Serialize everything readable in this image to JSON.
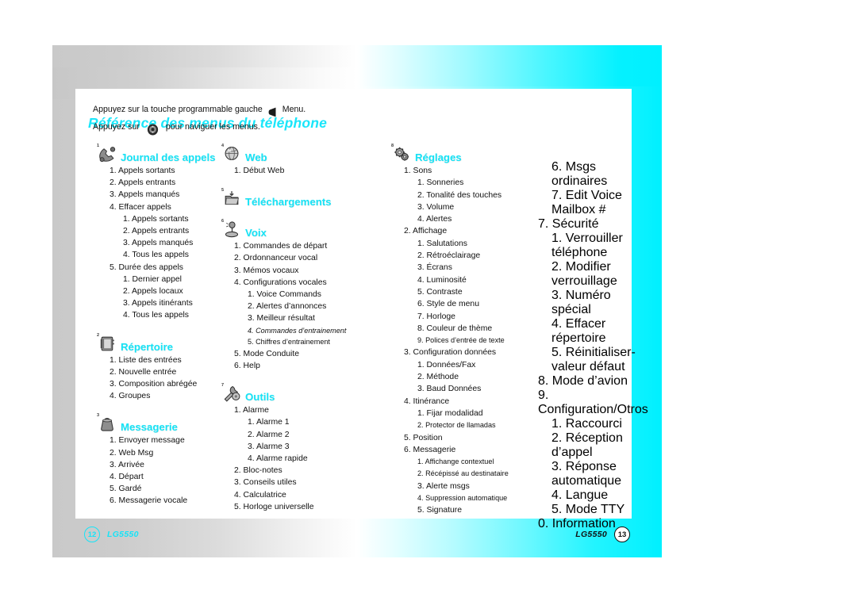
{
  "document": {
    "title": "Référence des menus du téléphone",
    "intro": [
      {
        "before": "Appuyez sur la touche programmable gauche",
        "icon": "softkey-icon",
        "after": "Menu."
      },
      {
        "before": "Appuyez sur",
        "icon": "navigation-key-icon",
        "after": "pour naviguer les menus."
      }
    ]
  },
  "footer": {
    "left": {
      "page": "12",
      "brand": "LG5550"
    },
    "right": {
      "page": "13",
      "brand": "LG5550"
    }
  },
  "colors": {
    "accent_cyan": "#16e4f7",
    "page_right_bg": "#00f0ff",
    "page_left_bg": "#cccccc",
    "text": "#111111"
  },
  "columns": [
    {
      "id": "column-1",
      "sections": [
        {
          "num": "1",
          "title": "Journal des appels",
          "icon": "phone-handset-icon",
          "items": [
            {
              "label": "1. Appels sortants"
            },
            {
              "label": "2. Appels entrants"
            },
            {
              "label": "3. Appels manqués"
            },
            {
              "label": "4. Effacer appels",
              "children": [
                {
                  "label": "1. Appels sortants"
                },
                {
                  "label": "2. Appels entrants"
                },
                {
                  "label": "3. Appels manqués"
                },
                {
                  "label": "4. Tous les appels"
                }
              ]
            },
            {
              "label": "5. Durée des appels",
              "children": [
                {
                  "label": "1. Dernier appel"
                },
                {
                  "label": "2. Appels locaux"
                },
                {
                  "label": "3. Appels itinérants"
                },
                {
                  "label": "4. Tous les appels"
                }
              ]
            }
          ]
        },
        {
          "num": "2",
          "title": "Répertoire",
          "icon": "address-book-icon",
          "items": [
            {
              "label": "1. Liste des entrées"
            },
            {
              "label": "2. Nouvelle entrée"
            },
            {
              "label": "3. Composition abrégée"
            },
            {
              "label": "4. Groupes"
            }
          ]
        },
        {
          "num": "3",
          "title": "Messagerie",
          "icon": "mailbag-icon",
          "items": [
            {
              "label": "1. Envoyer message"
            },
            {
              "label": "2. Web Msg"
            },
            {
              "label": "3. Arrivée"
            },
            {
              "label": "4. Départ"
            },
            {
              "label": "5. Gardé"
            },
            {
              "label": "6. Messagerie vocale"
            }
          ]
        }
      ]
    },
    {
      "id": "column-2",
      "sections": [
        {
          "num": "4",
          "title": "Web",
          "icon": "globe-icon",
          "items": [
            {
              "label": "1. Début Web"
            }
          ]
        },
        {
          "num": "5",
          "title": "Téléchargements",
          "icon": "download-folder-icon",
          "items": []
        },
        {
          "num": "6",
          "title": "Voix",
          "icon": "microphone-icon",
          "items": [
            {
              "label": "1. Commandes de départ"
            },
            {
              "label": "2. Ordonnanceur vocal"
            },
            {
              "label": "3. Mémos vocaux"
            },
            {
              "label": "4. Configurations vocales",
              "children": [
                {
                  "label": "1. Voice Commands"
                },
                {
                  "label": "2. Alertes d’annonces"
                },
                {
                  "label": "3. Meilleur résultat"
                },
                {
                  "label": "4. Commandes d’entrainement",
                  "small": true,
                  "italic": true
                },
                {
                  "label": "5. Chiffres d’entrainement",
                  "small": true
                }
              ]
            },
            {
              "label": "5. Mode Conduite"
            },
            {
              "label": "6. Help"
            }
          ]
        },
        {
          "num": "7",
          "title": "Outils",
          "icon": "tools-icon",
          "items": [
            {
              "label": "1. Alarme",
              "children": [
                {
                  "label": "1. Alarme 1"
                },
                {
                  "label": "2. Alarme 2"
                },
                {
                  "label": "3. Alarme 3"
                },
                {
                  "label": "4. Alarme rapide"
                }
              ]
            },
            {
              "label": "2. Bloc-notes"
            },
            {
              "label": "3. Conseils utiles"
            },
            {
              "label": "4. Calculatrice"
            },
            {
              "label": "5. Horloge universelle"
            }
          ]
        }
      ]
    },
    {
      "id": "column-3",
      "sections": [
        {
          "num": "8",
          "title": "Réglages",
          "icon": "settings-gears-icon",
          "items": [
            {
              "label": "1. Sons",
              "children": [
                {
                  "label": "1. Sonneries"
                },
                {
                  "label": "2. Tonalité des touches"
                },
                {
                  "label": "3. Volume"
                },
                {
                  "label": "4. Alertes"
                }
              ]
            },
            {
              "label": "2. Affichage",
              "children": [
                {
                  "label": "1. Salutations"
                },
                {
                  "label": "2. Rétroéclairage"
                },
                {
                  "label": "3. Écrans"
                },
                {
                  "label": "4. Luminosité"
                },
                {
                  "label": "5. Contraste"
                },
                {
                  "label": "6. Style de menu"
                },
                {
                  "label": "7. Horloge"
                },
                {
                  "label": "8. Couleur de thème"
                },
                {
                  "label": "9. Polices d’entrée de texte",
                  "small": true
                }
              ]
            },
            {
              "label": "3. Configuration données",
              "children": [
                {
                  "label": "1. Données/Fax"
                },
                {
                  "label": "2. Méthode"
                },
                {
                  "label": "3. Baud Données"
                }
              ]
            },
            {
              "label": "4. Itinérance",
              "children": [
                {
                  "label": "1. Fijar modalidad"
                },
                {
                  "label": "2. Protector de llamadas",
                  "small": true
                }
              ]
            },
            {
              "label": "5. Position"
            },
            {
              "label": "6. Messagerie",
              "children": [
                {
                  "label": "1. Affichange contextuel",
                  "small": true
                },
                {
                  "label": "2. Récépissé au destinataire",
                  "small": true
                },
                {
                  "label": "3. Alerte msgs"
                },
                {
                  "label": "4. Suppression automatique",
                  "small": true
                },
                {
                  "label": "5. Signature"
                }
              ]
            }
          ]
        }
      ]
    },
    {
      "id": "column-4",
      "continuation": true,
      "sections": [
        {
          "num": "",
          "title": "",
          "icon": "",
          "items": [
            {
              "label": "6. Msgs ordinaires",
              "indent": 2
            },
            {
              "label": "7. Edit Voice Mailbox #",
              "indent": 2
            },
            {
              "label": "7. Sécurité",
              "indent": 1,
              "children": [
                {
                  "label": "1. Verrouiller téléphone"
                },
                {
                  "label": "2. Modifier verrouillage"
                },
                {
                  "label": "3. Numéro spécial"
                },
                {
                  "label": "4. Effacer répertoire"
                },
                {
                  "label": "5. Réinitialiser-valeur défaut",
                  "small": true
                }
              ]
            },
            {
              "label": "8. Mode d’avion",
              "indent": 1
            },
            {
              "label": "9. Configuration/Otros",
              "indent": 1,
              "children": [
                {
                  "label": "1. Raccourci"
                },
                {
                  "label": "2. Réception d’appel"
                },
                {
                  "label": "3. Réponse automatique",
                  "small": true
                },
                {
                  "label": "4. Langue"
                },
                {
                  "label": "5. Mode TTY"
                }
              ]
            },
            {
              "label": "0. Information",
              "indent": 1
            }
          ]
        }
      ]
    }
  ]
}
